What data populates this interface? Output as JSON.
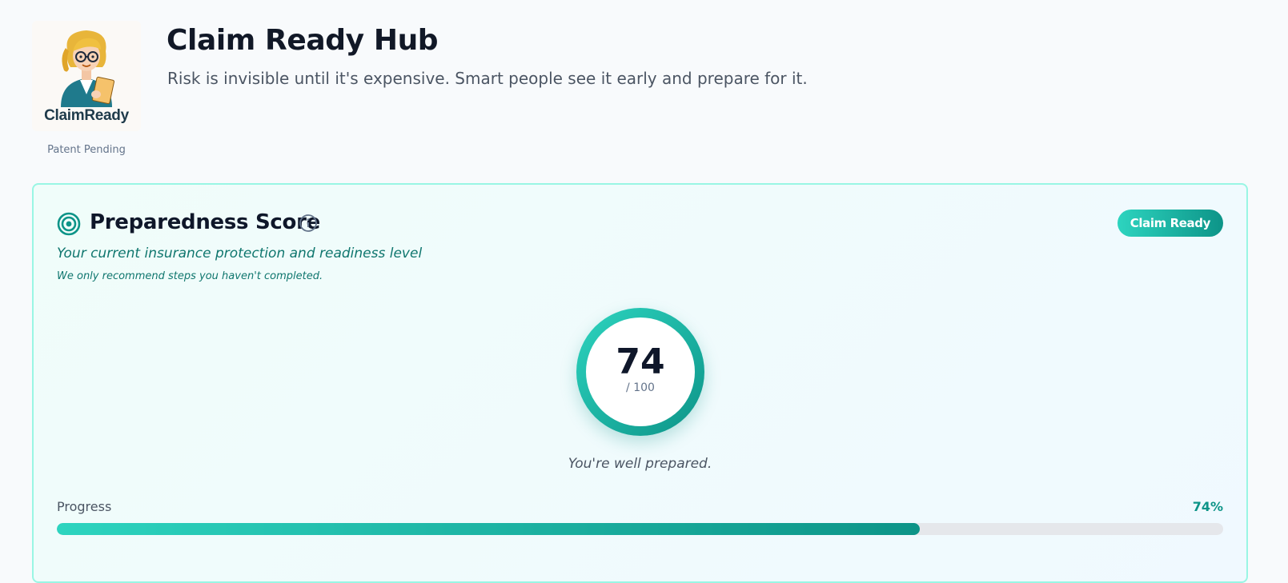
{
  "header": {
    "logo_text": "ClaimReady",
    "patent": "Patent Pending",
    "title": "Claim Ready Hub",
    "tagline": "Risk is invisible until it's expensive. Smart people see it early and prepare for it."
  },
  "score_card": {
    "icon": "target-icon",
    "title": "Preparedness Score",
    "info_icon": "info-icon",
    "subtitle": "Your current insurance protection and readiness level",
    "note": "We only recommend steps you haven't completed.",
    "badge": "Claim Ready",
    "score": "74",
    "score_max": "/ 100",
    "caption": "You're well prepared.",
    "progress_label": "Progress",
    "progress_pct_text": "74%",
    "progress_value": 0.74
  },
  "colors": {
    "accent": "#0d9488",
    "accent_light": "#2dd4bf",
    "card_border": "#99f6e4"
  }
}
